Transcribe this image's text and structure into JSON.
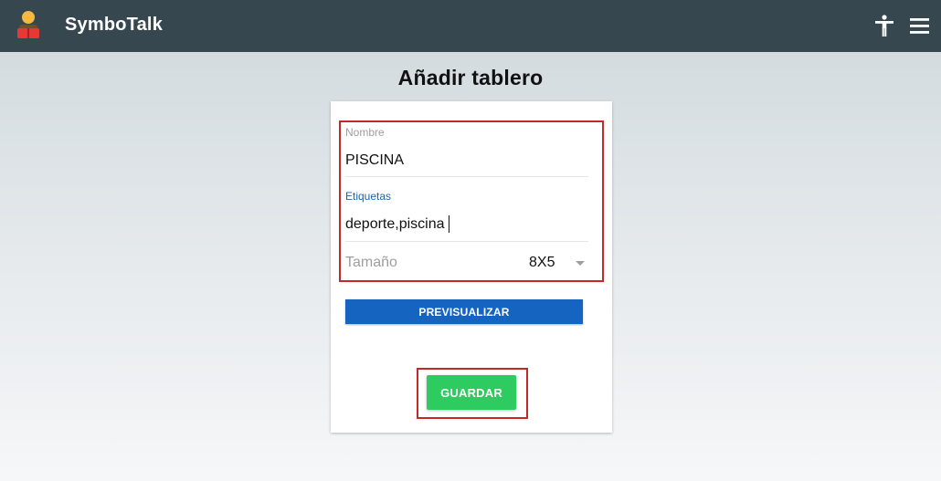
{
  "app": {
    "title": "SymboTalk",
    "logo_icon": "person-reading-icon",
    "accessibility_icon": "accessibility-icon",
    "menu_icon": "hamburger-menu-icon",
    "header_color": "#37474f"
  },
  "page": {
    "title": "Añadir tablero"
  },
  "form": {
    "name_label": "Nombre",
    "name_value": "PISCINA",
    "tags_label": "Etiquetas",
    "tags_value": "deporte,piscina",
    "size_label": "Tamaño",
    "size_value": "8X5",
    "focused_label_color": "#1e63b0"
  },
  "actions": {
    "preview_label": "PREVISUALIZAR",
    "preview_color": "#1565c0",
    "save_label": "GUARDAR",
    "save_color": "#2ecc60"
  },
  "annotations": {
    "highlight_color": "#c62828"
  }
}
